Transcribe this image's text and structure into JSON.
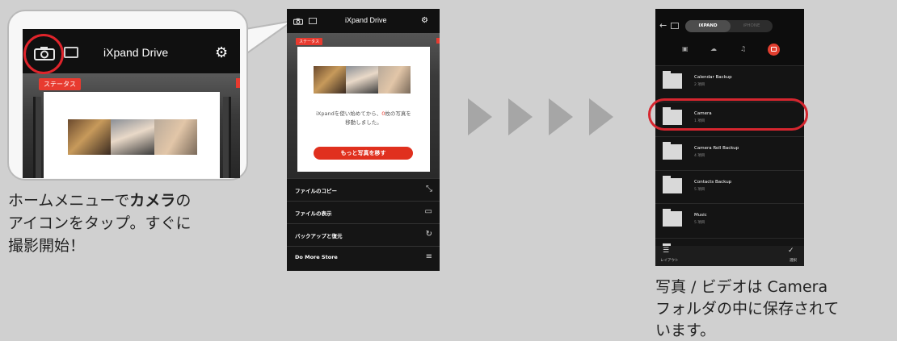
{
  "callout": {
    "title": "iXpand Drive",
    "badge": "ステータス"
  },
  "caption_left": {
    "line1_pre": "ホームメニューで",
    "line1_bold": "カメラ",
    "line1_post": "の",
    "line2": "アイコンをタップ。すぐに",
    "line3": "撮影開始！"
  },
  "phone1": {
    "title": "iXpand Drive",
    "badge": "ステータス",
    "status_line1_pre": "iXpandを使い始めてから、",
    "status_count": "0",
    "status_line1_post": "枚の写真を",
    "status_line2": "移動しました。",
    "more_button": "もっと写真を移す",
    "menu": [
      {
        "label": "ファイルのコピー",
        "icon": "copy-arrows-icon",
        "glyph": "⤡"
      },
      {
        "label": "ファイルの表示",
        "icon": "folder-icon",
        "glyph": "▭"
      },
      {
        "label": "バックアップと復元",
        "icon": "sync-icon",
        "glyph": "↻"
      },
      {
        "label": "Do More Store",
        "icon": "menu-icon",
        "glyph": "≡"
      }
    ]
  },
  "phone2": {
    "seg_left": "iXPAND",
    "seg_right": "iPHONE",
    "folders": [
      {
        "name": "Calendar Backup",
        "count": "2 項目"
      },
      {
        "name": "Camera",
        "count": "1 項目"
      },
      {
        "name": "Camera Roll Backup",
        "count": "4 項目"
      },
      {
        "name": "Contacts Backup",
        "count": "5 項目"
      },
      {
        "name": "Music",
        "count": "5 項目"
      }
    ],
    "footer_left": "レイアウト",
    "footer_right": "選択"
  },
  "caption_right": {
    "line1": "写真 / ビデオは Camera",
    "line2": "フォルダの中に保存されて",
    "line3": "います。"
  },
  "colors": {
    "background": "#d0d0d0",
    "accent_red": "#e0301e",
    "highlight_circle": "#d6262f",
    "arrow_gray": "#a6a6a6"
  }
}
